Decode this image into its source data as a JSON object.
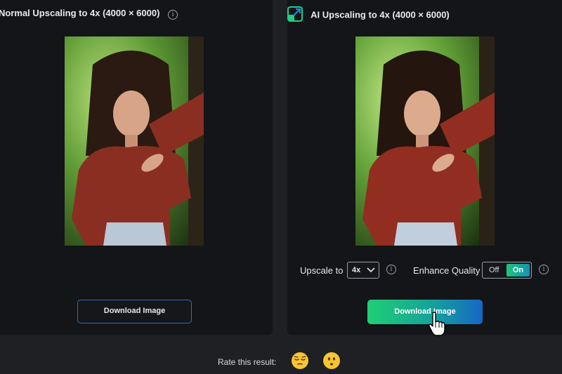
{
  "left_panel": {
    "title": "Normal Upscaling to 4x (4000 × 6000)",
    "download_label": "Download Image"
  },
  "right_panel": {
    "title": "AI Upscaling to 4x (4000 × 6000)",
    "upscale_label": "Upscale to",
    "upscale_value": "4x",
    "enhance_label": "Enhance Quality",
    "toggle_off": "Off",
    "toggle_on": "On",
    "download_label": "Download Image"
  },
  "rating": {
    "label": "Rate this result:",
    "options": [
      "face-relieved-emoji",
      "face-hushed-emoji"
    ]
  },
  "icons": {
    "info": "i"
  },
  "colors": {
    "accent_green": "#1fcf73",
    "accent_blue": "#1567c4",
    "outline_blue": "#2f6fb5"
  }
}
